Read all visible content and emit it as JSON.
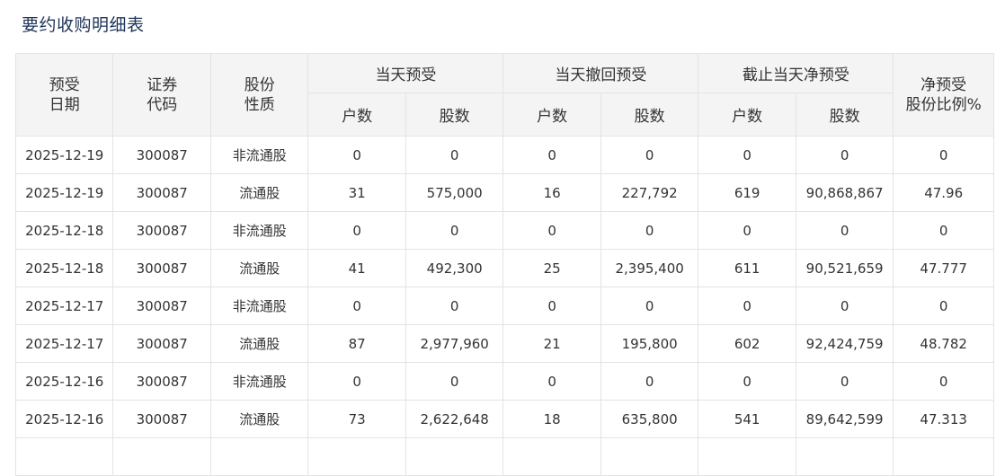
{
  "page_title": "要约收购明细表",
  "table": {
    "headers": {
      "date_line1": "预受",
      "date_line2": "日期",
      "code_line1": "证券",
      "code_line2": "代码",
      "type_line1": "股份",
      "type_line2": "性质",
      "group_today": "当天预受",
      "group_withdraw": "当天撤回预受",
      "group_net": "截止当天净预受",
      "ratio_line1": "净预受",
      "ratio_line2": "股份比例%",
      "sub_households": "户数",
      "sub_shares": "股数"
    },
    "rows": [
      {
        "date": "2025-12-19",
        "code": "300087",
        "type": "非流通股",
        "today_h": "0",
        "today_s": "0",
        "wd_h": "0",
        "wd_s": "0",
        "net_h": "0",
        "net_s": "0",
        "ratio": "0"
      },
      {
        "date": "2025-12-19",
        "code": "300087",
        "type": "流通股",
        "today_h": "31",
        "today_s": "575,000",
        "wd_h": "16",
        "wd_s": "227,792",
        "net_h": "619",
        "net_s": "90,868,867",
        "ratio": "47.96"
      },
      {
        "date": "2025-12-18",
        "code": "300087",
        "type": "非流通股",
        "today_h": "0",
        "today_s": "0",
        "wd_h": "0",
        "wd_s": "0",
        "net_h": "0",
        "net_s": "0",
        "ratio": "0"
      },
      {
        "date": "2025-12-18",
        "code": "300087",
        "type": "流通股",
        "today_h": "41",
        "today_s": "492,300",
        "wd_h": "25",
        "wd_s": "2,395,400",
        "net_h": "611",
        "net_s": "90,521,659",
        "ratio": "47.777"
      },
      {
        "date": "2025-12-17",
        "code": "300087",
        "type": "非流通股",
        "today_h": "0",
        "today_s": "0",
        "wd_h": "0",
        "wd_s": "0",
        "net_h": "0",
        "net_s": "0",
        "ratio": "0"
      },
      {
        "date": "2025-12-17",
        "code": "300087",
        "type": "流通股",
        "today_h": "87",
        "today_s": "2,977,960",
        "wd_h": "21",
        "wd_s": "195,800",
        "net_h": "602",
        "net_s": "92,424,759",
        "ratio": "48.782"
      },
      {
        "date": "2025-12-16",
        "code": "300087",
        "type": "非流通股",
        "today_h": "0",
        "today_s": "0",
        "wd_h": "0",
        "wd_s": "0",
        "net_h": "0",
        "net_s": "0",
        "ratio": "0"
      },
      {
        "date": "2025-12-16",
        "code": "300087",
        "type": "流通股",
        "today_h": "73",
        "today_s": "2,622,648",
        "wd_h": "18",
        "wd_s": "635,800",
        "net_h": "541",
        "net_s": "89,642,599",
        "ratio": "47.313"
      }
    ]
  }
}
